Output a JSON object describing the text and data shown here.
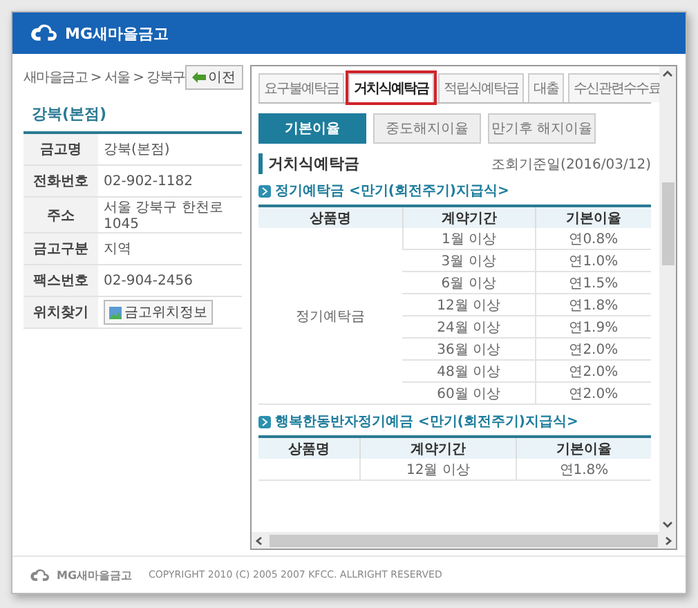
{
  "header": {
    "logo_text": "MG새마을금고"
  },
  "sidebar": {
    "breadcrumb": "새마을금고 > 서울 > 강북구",
    "back_button": "이전",
    "branch_title": "강북(본점)",
    "info": [
      {
        "label": "금고명",
        "value": "강북(본점)",
        "kind": "text"
      },
      {
        "label": "전화번호",
        "value": "02-902-1182",
        "kind": "text"
      },
      {
        "label": "주소",
        "value": "서울 강북구 한천로 1045",
        "kind": "text"
      },
      {
        "label": "금고구분",
        "value": "지역",
        "kind": "text"
      },
      {
        "label": "팩스번호",
        "value": "02-904-2456",
        "kind": "text"
      },
      {
        "label": "위치찾기",
        "value": "금고위치정보",
        "kind": "button"
      }
    ]
  },
  "tabs": [
    {
      "label": "요구불예탁금",
      "selected": false
    },
    {
      "label": "거치식예탁금",
      "selected": true
    },
    {
      "label": "적립식예탁금",
      "selected": false
    },
    {
      "label": "대출",
      "selected": false
    },
    {
      "label": "수신관련수수료",
      "selected": false
    }
  ],
  "subtabs": [
    {
      "label": "기본이율",
      "selected": true
    },
    {
      "label": "중도해지이율",
      "selected": false
    },
    {
      "label": "만기후 해지이율",
      "selected": false
    }
  ],
  "section": {
    "title": "거치식예탁금",
    "reference_date": "조회기준일(2016/03/12)"
  },
  "products": [
    {
      "title": "정기예탁금 <만기(회전주기)지급식>",
      "columns": [
        "상품명",
        "계약기간",
        "기본이율"
      ],
      "name": "정기예탁금",
      "rows": [
        {
          "period": "1월 이상",
          "rate": "연0.8%"
        },
        {
          "period": "3월 이상",
          "rate": "연1.0%"
        },
        {
          "period": "6월 이상",
          "rate": "연1.5%"
        },
        {
          "period": "12월 이상",
          "rate": "연1.8%"
        },
        {
          "period": "24월 이상",
          "rate": "연1.9%"
        },
        {
          "period": "36월 이상",
          "rate": "연2.0%"
        },
        {
          "period": "48월 이상",
          "rate": "연2.0%"
        },
        {
          "period": "60월 이상",
          "rate": "연2.0%"
        }
      ]
    },
    {
      "title": "행복한동반자정기예금 <만기(회전주기)지급식>",
      "columns": [
        "상품명",
        "계약기간",
        "기본이율"
      ],
      "rows": [
        {
          "period": "12월 이상",
          "rate": "연1.8%"
        }
      ]
    }
  ],
  "footer": {
    "logo_text": "MG새마을금고",
    "copyright": "COPYRIGHT 2010 (C) 2005 2007 KFCC. ALLRIGHT RESERVED"
  }
}
